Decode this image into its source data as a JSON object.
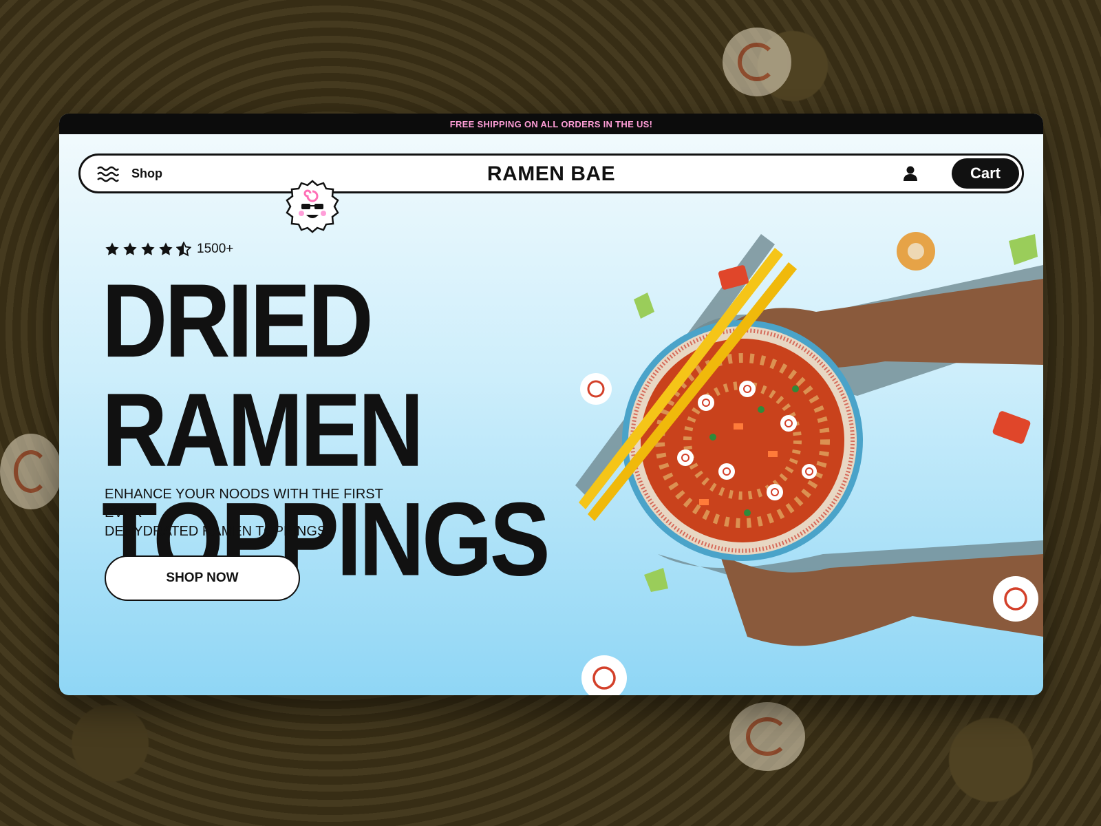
{
  "promo": {
    "text": "FREE SHIPPING ON ALL ORDERS IN THE US!"
  },
  "nav": {
    "menu_icon": "wavy-menu-icon",
    "shop_label": "Shop",
    "brand": "RAMEN BAE",
    "user_icon": "user-icon",
    "cart_label": "Cart"
  },
  "hero": {
    "rating": {
      "stars": 4.5,
      "count": "1500+"
    },
    "headline_line1": "DRIED RAMEN",
    "headline_line2": "TOPPINGS",
    "subtext_line1": "ENHANCE YOUR NOODS WITH THE FIRST EVER",
    "subtext_line2": "DEHYDRATED RAMEN TOPPINGS",
    "cta_label": "SHOP NOW"
  },
  "colors": {
    "promo_text": "#ff9ed8",
    "ink": "#111111",
    "sky_top": "#f4fbfd",
    "sky_bottom": "#8fd6f5",
    "chopsticks": "#f5c518",
    "broth": "#c9421c"
  }
}
